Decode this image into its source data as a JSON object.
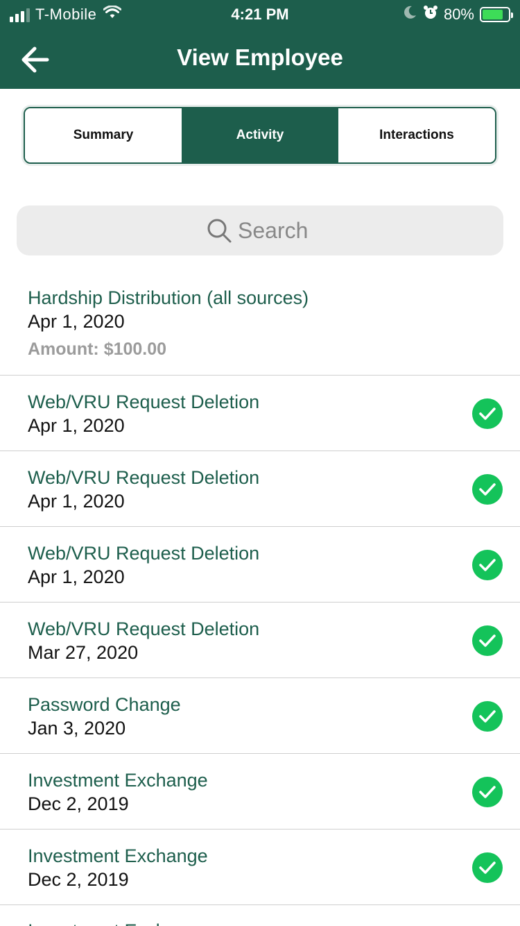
{
  "status_bar": {
    "carrier": "T-Mobile",
    "time": "4:21 PM",
    "battery_percent": "80%",
    "battery_level": 0.8,
    "icons": [
      "signal-icon",
      "wifi-icon",
      "moon-icon",
      "alarm-icon",
      "battery-icon"
    ]
  },
  "nav": {
    "title": "View Employee",
    "back_icon": "arrow-left-icon"
  },
  "colors": {
    "brand": "#1d5e4c",
    "success": "#14c35a",
    "muted": "#9b9b9b"
  },
  "tabs": [
    {
      "label": "Summary",
      "active": false
    },
    {
      "label": "Activity",
      "active": true
    },
    {
      "label": "Interactions",
      "active": false
    }
  ],
  "search": {
    "placeholder": "Search",
    "icon": "search-icon"
  },
  "activity": [
    {
      "title": "Hardship Distribution (all sources)",
      "date": "Apr 1, 2020",
      "amount": "Amount: $100.00",
      "status": "none"
    },
    {
      "title": "Web/VRU Request Deletion",
      "date": "Apr 1, 2020",
      "status": "complete"
    },
    {
      "title": "Web/VRU Request Deletion",
      "date": "Apr 1, 2020",
      "status": "complete"
    },
    {
      "title": "Web/VRU Request Deletion",
      "date": "Apr 1, 2020",
      "status": "complete"
    },
    {
      "title": "Web/VRU Request Deletion",
      "date": "Mar 27, 2020",
      "status": "complete"
    },
    {
      "title": "Password Change",
      "date": "Jan 3, 2020",
      "status": "complete"
    },
    {
      "title": "Investment Exchange",
      "date": "Dec 2, 2019",
      "status": "complete"
    },
    {
      "title": "Investment Exchange",
      "date": "Dec 2, 2019",
      "status": "complete"
    },
    {
      "title": "Investment Exchange",
      "status": "complete"
    }
  ]
}
